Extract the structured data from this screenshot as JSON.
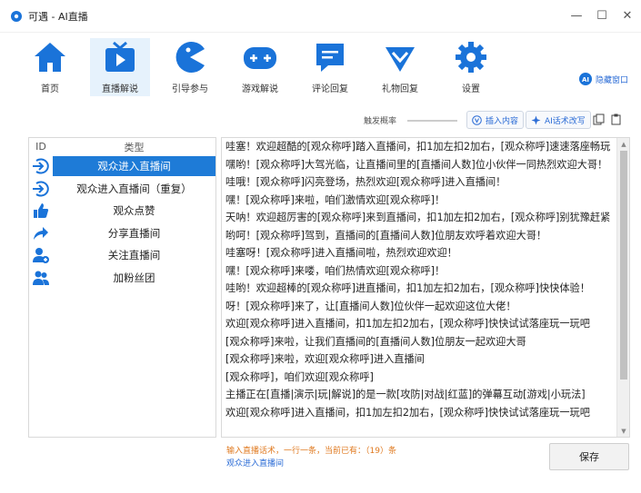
{
  "window": {
    "title": "可遇 - AI直播",
    "controls": [
      "—",
      "☐",
      "✕"
    ]
  },
  "toolbar": {
    "items": [
      {
        "label": "首页",
        "icon": "home-icon"
      },
      {
        "label": "直播解说",
        "icon": "tv-icon",
        "active": true
      },
      {
        "label": "引导参与",
        "icon": "pacman-icon"
      },
      {
        "label": "游戏解说",
        "icon": "gamepad-icon"
      },
      {
        "label": "评论回复",
        "icon": "comment-icon"
      },
      {
        "label": "礼物回复",
        "icon": "gift-icon"
      },
      {
        "label": "设置",
        "icon": "gear-icon"
      }
    ],
    "hide_window": "隐藏窗口",
    "hide_badge": "AI"
  },
  "options": {
    "trigger_label": "触发概率",
    "insert_label": "插入内容",
    "ai_label": "AI话术改写"
  },
  "list": {
    "header_id": "ID",
    "header_type": "类型",
    "items": [
      {
        "label": "观众进入直播间",
        "icon": "enter-icon"
      },
      {
        "label": "观众进入直播间（重复）",
        "icon": "enter-icon"
      },
      {
        "label": "观众点赞",
        "icon": "thumbs-up-icon"
      },
      {
        "label": "分享直播间",
        "icon": "share-icon"
      },
      {
        "label": "关注直播间",
        "icon": "add-user-icon"
      },
      {
        "label": "加粉丝团",
        "icon": "group-icon"
      }
    ]
  },
  "script_lines": [
    "哇塞！欢迎超酷的[观众称呼]踏入直播间，扣1加左扣2加右，[观众称呼]速速落座畅玩",
    "嘿哟！[观众称呼]大驾光临，让直播间里的[直播间人数]位小伙伴一同热烈欢迎大哥！",
    "哇哦！[观众称呼]闪亮登场，热烈欢迎[观众称呼]进入直播间！",
    "嘿！[观众称呼]来啦，咱们激情欢迎[观众称呼]！",
    "天呐！欢迎超厉害的[观众称呼]来到直播间，扣1加左扣2加右，[观众称呼]别犹豫赶紧",
    "哟呵！[观众称呼]驾到，直播间的[直播间人数]位朋友欢呼着欢迎大哥！",
    "哇塞呀！[观众称呼]进入直播间啦，热烈欢迎欢迎！",
    "嘿！[观众称呼]来喽，咱们热情欢迎[观众称呼]！",
    "哇哟！欢迎超棒的[观众称呼]进直播间，扣1加左扣2加右，[观众称呼]快快体验！",
    "呀！[观众称呼]来了，让[直播间人数]位伙伴一起欢迎这位大佬！",
    "欢迎[观众称呼]进入直播间，扣1加左扣2加右，[观众称呼]快快试试落座玩一玩吧",
    "[观众称呼]来啦，让我们直播间的[直播间人数]位朋友一起欢迎大哥",
    "[观众称呼]来啦，欢迎[观众称呼]进入直播间",
    "[观众称呼]，咱们欢迎[观众称呼]",
    "主播正在[直播|演示|玩|解说]的是一款[攻防|对战|红蓝]的弹幕互动[游戏|小玩法]",
    "欢迎[观众称呼]进入直播间，扣1加左扣2加右，[观众称呼]快快试试落座玩一玩吧"
  ],
  "footer": {
    "hint": "输入直播话术，一行一条，当前已有：（19）条",
    "current": "观众进入直播间",
    "save": "保存"
  },
  "colors": {
    "accent": "#1e7bd7",
    "icon_blue": "#1a73d9",
    "hint_orange": "#e07b22"
  }
}
